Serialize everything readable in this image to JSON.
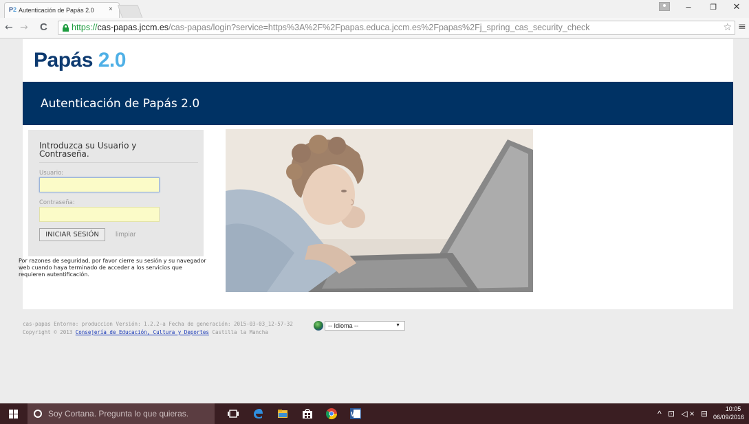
{
  "browser": {
    "tab_title": "Autenticación de Papás 2.0",
    "favicon_text_a": "P",
    "favicon_text_b": "2",
    "tab_close": "×",
    "url_scheme": "https://",
    "url_host": "cas-papas.jccm.es",
    "url_path": "/cas-papas/login?service=https%3A%2F%2Fpapas.educa.jccm.es%2Fpapas%2Fj_spring_cas_security_check",
    "window_controls": {
      "minimize": "–",
      "restore": "❐",
      "close": "✕"
    },
    "nav": {
      "back": "←",
      "forward": "→",
      "reload": "C"
    },
    "star": "☆",
    "menu": "≡"
  },
  "page": {
    "logo_part1": "Papás",
    "logo_part2": "2.0",
    "banner_title": "Autenticación de Papás 2.0",
    "login": {
      "heading": "Introduzca su Usuario y Contraseña.",
      "username_label": "Usuario:",
      "username_value": "",
      "password_label": "Contraseña:",
      "password_value": "",
      "submit_label": "INICIAR SESIÓN",
      "clear_label": "limpiar"
    },
    "security_note": "Por razones de seguridad, por favor cierre su sesión y su navegador web cuando haya terminado de acceder a los servicios que requieren autentificación.",
    "footer": {
      "line1": "cas-papas Entorno: produccion Versión: 1.2.2-a Fecha de generación: 2015-03-03_12-57-32",
      "copyright_prefix": "Copyright © 2013",
      "link_text": "Consejería de Educación, Cultura y Deportes",
      "copyright_suffix": "Castilla la Mancha",
      "language_selected": "-- Idioma --",
      "language_arrow": "▼"
    }
  },
  "taskbar": {
    "cortana_placeholder": "Soy Cortana. Pregunta lo que quieras.",
    "tray_glyphs": "^ ⊡ ◁× ⊟",
    "time": "10:05",
    "date": "06/09/2016"
  },
  "colors": {
    "banner": "#003264",
    "logo_dark": "#0d3a70",
    "logo_light": "#4fb0e6",
    "field_autofill": "#fbfbc8",
    "taskbar": "#3a1e22"
  }
}
